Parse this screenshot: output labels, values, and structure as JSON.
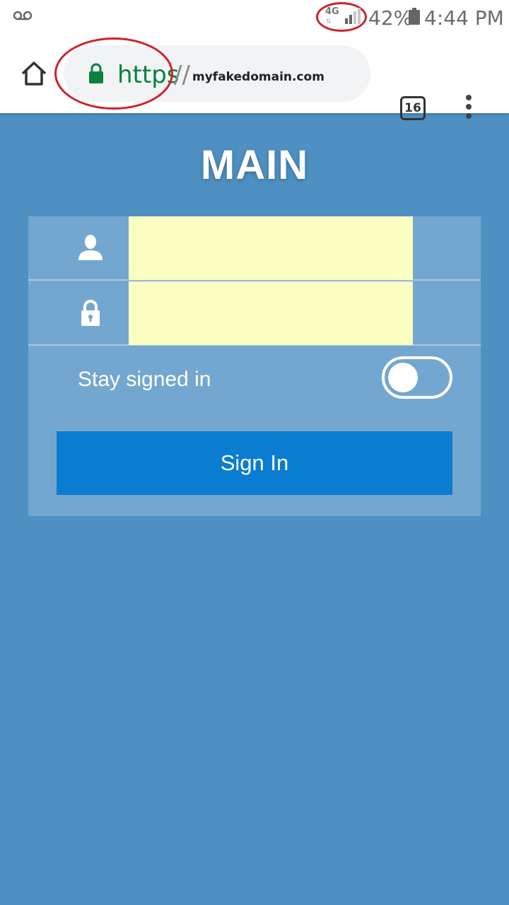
{
  "status_bar": {
    "network": "4G",
    "network_arrows": "⇅",
    "battery": "42%",
    "time": "4:44 PM",
    "icons": [
      "voicemail-icon",
      "signal-icon",
      "battery-icon"
    ]
  },
  "browser": {
    "url_scheme": "https",
    "url_slashes": "//",
    "url_domain": "myfakedomain.com",
    "tab_count": "16",
    "icons": [
      "home-icon",
      "lock-icon",
      "overflow-menu-icon"
    ],
    "colors": {
      "secure": "#0b8043",
      "annotation": "#d0202a"
    }
  },
  "page": {
    "title": "MAIN",
    "username": {
      "value": "",
      "placeholder": ""
    },
    "password": {
      "value": "",
      "placeholder": ""
    },
    "stay_signed_in": {
      "label": "Stay signed in",
      "checked": false
    },
    "signin_label": "Sign In",
    "icons": [
      "user-icon",
      "padlock-icon"
    ],
    "colors": {
      "background": "#4e90c1",
      "panel": "#74a7cf",
      "field": "#fafec0",
      "button": "#0a7dd1"
    }
  }
}
